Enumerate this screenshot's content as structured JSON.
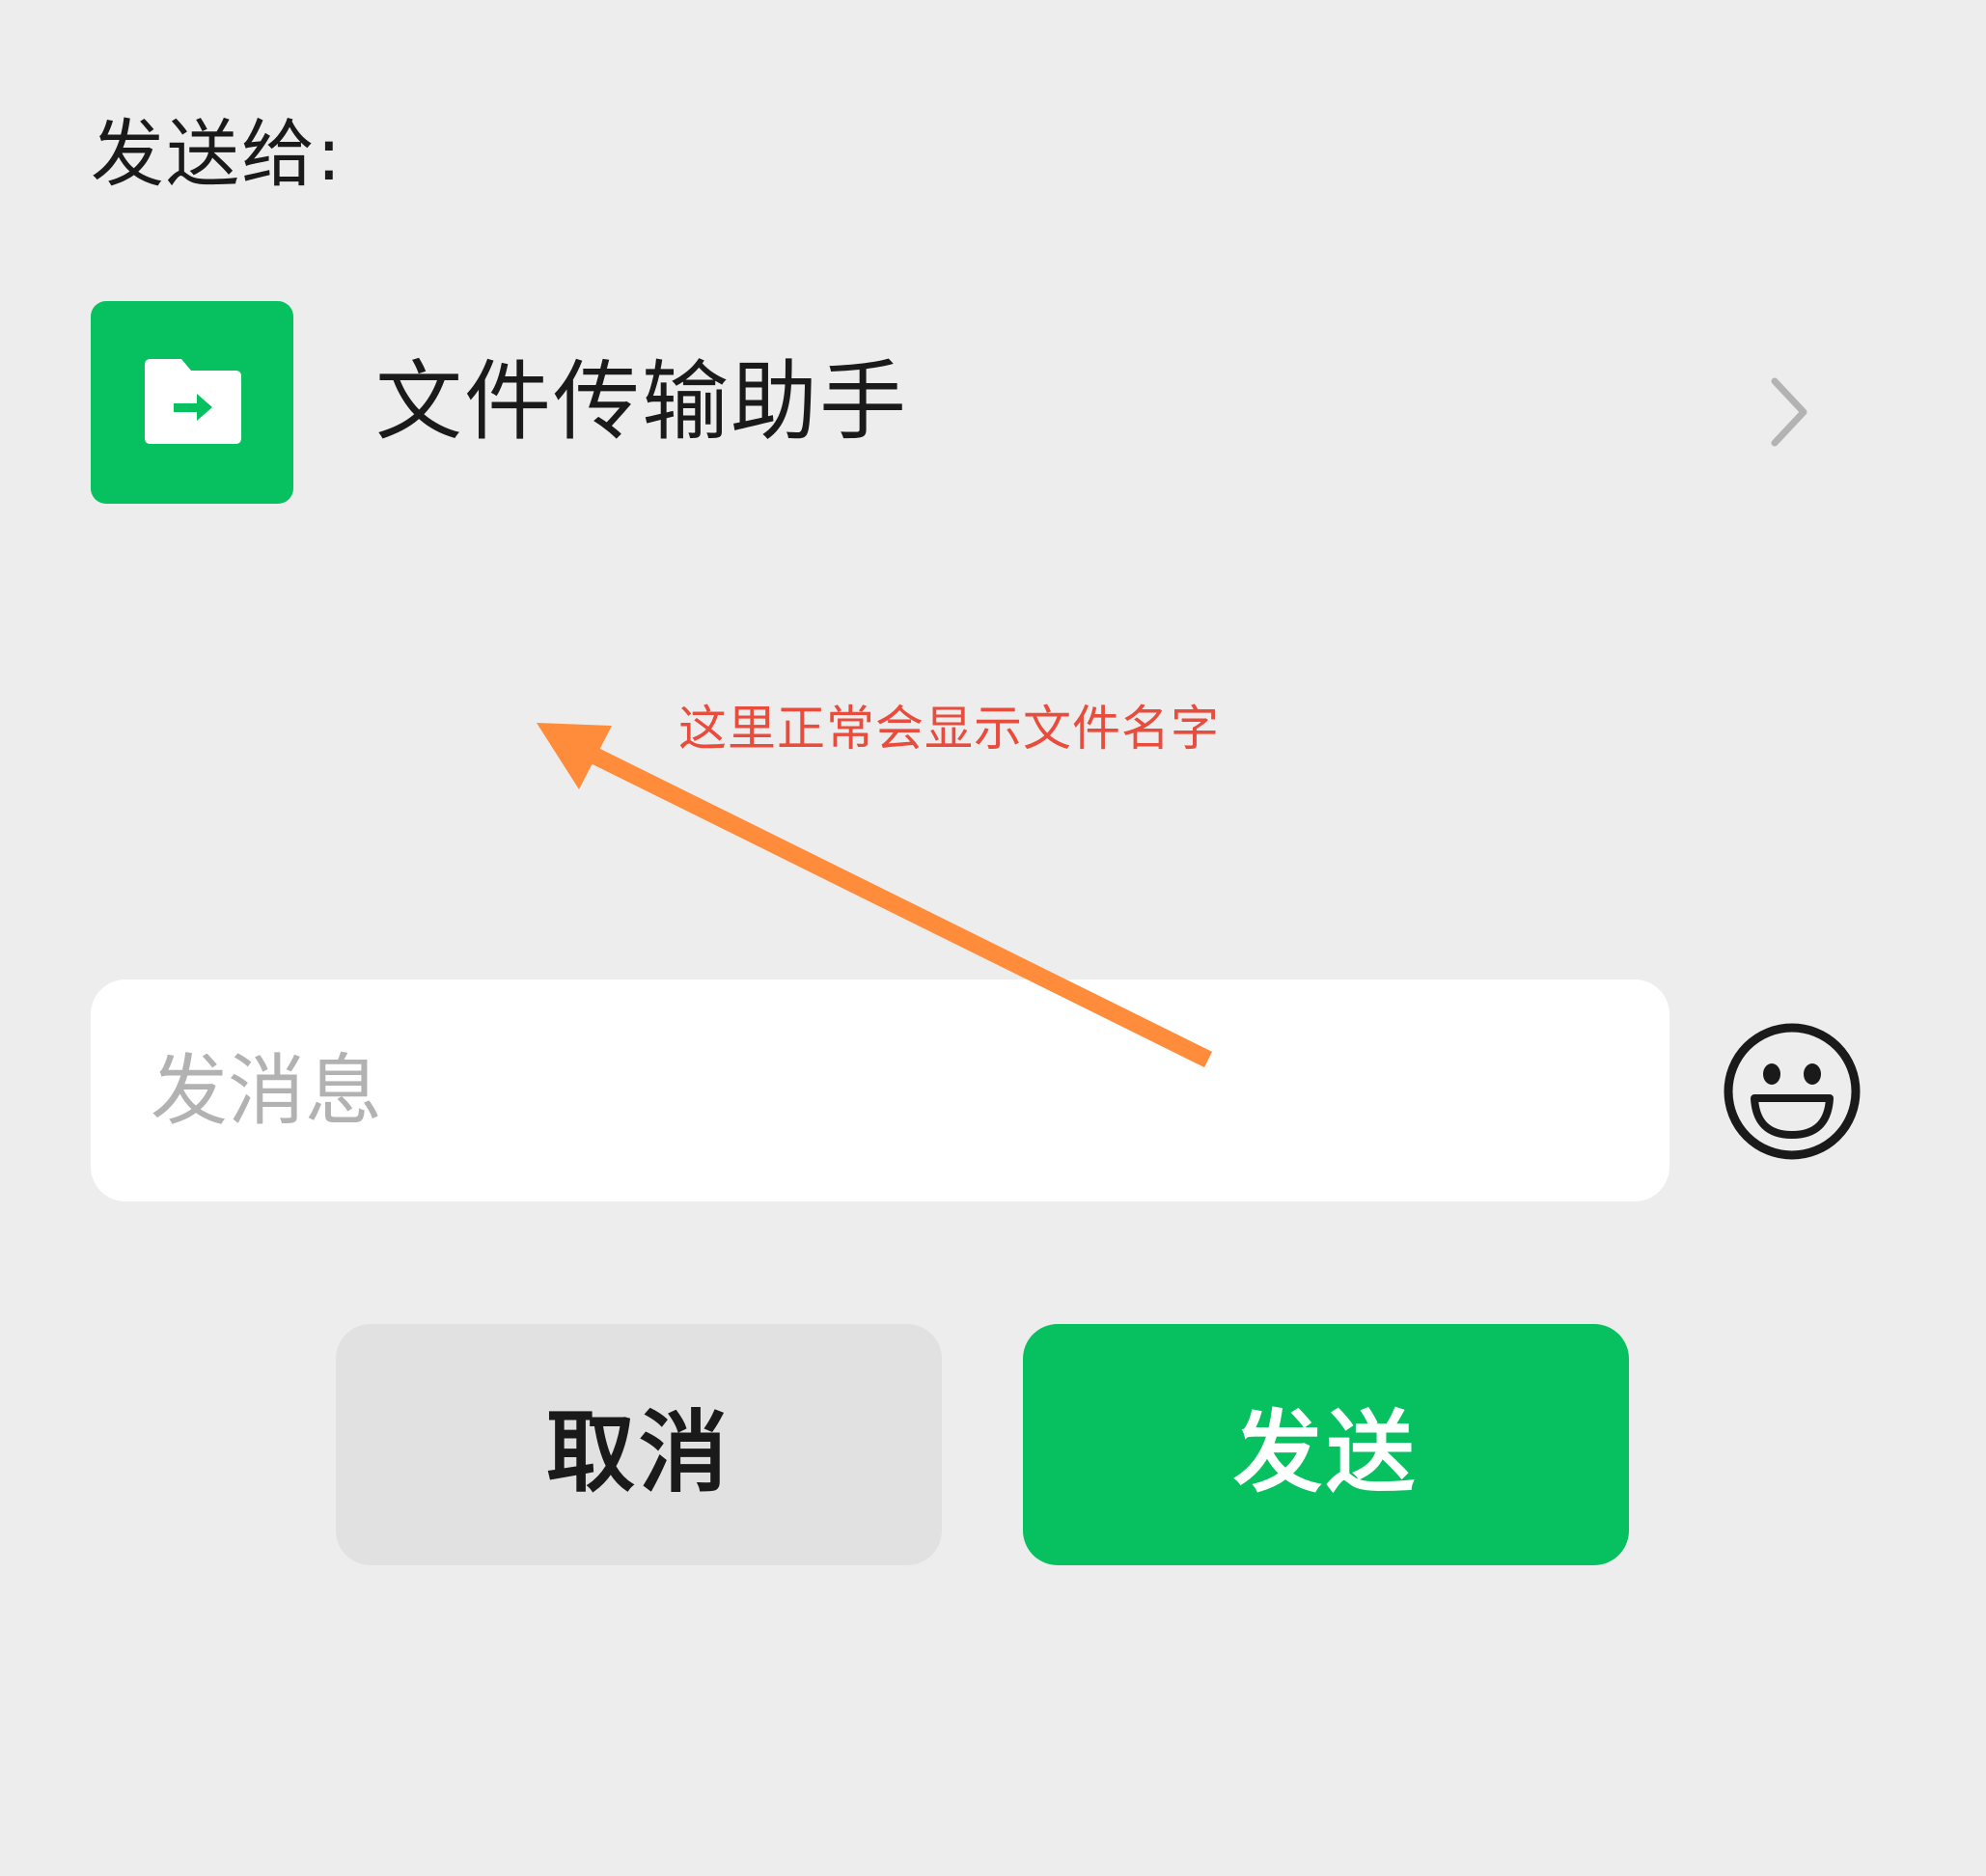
{
  "dialog": {
    "send_to_label": "发送给:",
    "recipient": {
      "name": "文件传输助手",
      "avatar_icon": "folder-transfer-icon",
      "avatar_color": "#07c160"
    },
    "annotation": {
      "text": "这里正常会显示文件名字",
      "text_color": "#e74c3c",
      "arrow_color": "#ff8c3a"
    },
    "message": {
      "placeholder": "发消息",
      "value": ""
    },
    "emoji_icon": "smiley-face-icon",
    "buttons": {
      "cancel_label": "取消",
      "send_label": "发送"
    },
    "colors": {
      "background": "#ededed",
      "accent": "#07c160",
      "cancel_bg": "#e1e1e1"
    }
  }
}
